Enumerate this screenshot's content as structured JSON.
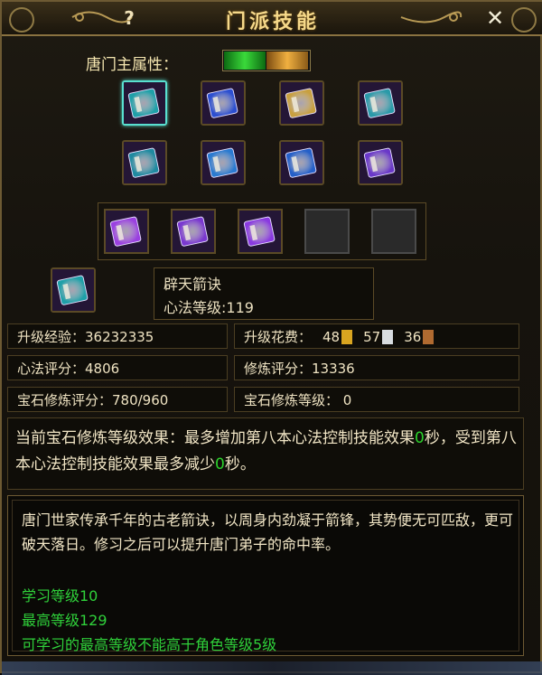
{
  "window": {
    "title": "门派技能",
    "help_label": "?",
    "close_label": "✕"
  },
  "sect": {
    "attribute_label": "唐门主属性："
  },
  "books": [
    {
      "icon": "teal-book-icon",
      "color": "#1fa0a8",
      "selected": true
    },
    {
      "icon": "blue-book-icon",
      "color": "#2c4fd0"
    },
    {
      "icon": "gold-book-icon",
      "color": "#c8a040"
    },
    {
      "icon": "teal-book-icon",
      "color": "#2a9aa8"
    },
    {
      "icon": "teal-book-icon",
      "color": "#1f8aa0"
    },
    {
      "icon": "blue-book-icon",
      "color": "#2a7ad0"
    },
    {
      "icon": "blue-book-icon",
      "color": "#2560c8"
    },
    {
      "icon": "vortex-icon",
      "color": "#6a38c8"
    }
  ],
  "skills": [
    {
      "icon": "slash-skill-icon",
      "color": "#9a40e0",
      "selected": true
    },
    {
      "icon": "claw-skill-icon",
      "color": "#7a38d0"
    },
    {
      "icon": "meditate-skill-icon",
      "color": "#8a3ae0"
    },
    {
      "icon": "empty-slot",
      "empty": true
    },
    {
      "icon": "empty-slot",
      "empty": true
    }
  ],
  "current_skill": {
    "icon": "teal-book-icon",
    "name": "辟天箭诀",
    "level_text": "心法等级:119"
  },
  "stats": {
    "exp": "升级经验：36232335",
    "cost_label": "升级花费：",
    "costs": [
      {
        "amount": "48",
        "icon": "gold-token-icon",
        "color": "#d9a520"
      },
      {
        "amount": "57",
        "icon": "silver-token-icon",
        "color": "#d8dce0"
      },
      {
        "amount": "36",
        "icon": "bronze-token-icon",
        "color": "#b06a30"
      }
    ],
    "score": "心法评分：4806",
    "practice_score": "修炼评分：13336",
    "gem_score": "宝石修炼评分：780/960",
    "gem_level": "宝石修炼等级： 0"
  },
  "effect": {
    "part1": "当前宝石修炼等级效果：最多增加第八本心法控制技能效果",
    "value1": "0",
    "part2": "秒，受到第八本心法控制技能效果最多减少",
    "value2": "0",
    "part3": "秒。"
  },
  "description": {
    "text": "唐门世家传承千年的古老箭诀，以周身内劲凝于箭锋，其势便无可匹敌，更可破天落日。修习之后可以提升唐门弟子的命中率。",
    "learn_level": "学习等级10",
    "max_level": "最高等级129",
    "limit": "可学习的最高等级不能高于角色等级5级"
  },
  "colors": {
    "accent": "#f6d98a",
    "green": "#2bd12b",
    "border": "#5b4a26"
  }
}
